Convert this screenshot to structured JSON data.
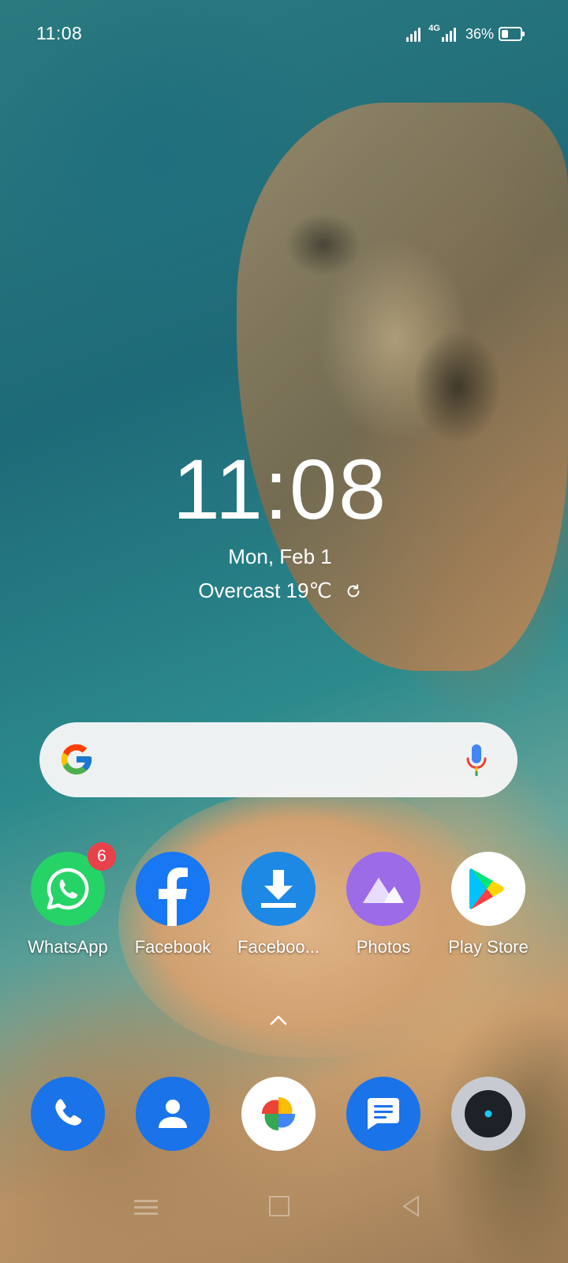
{
  "status_bar": {
    "time": "11:08",
    "network_label": "4G",
    "battery_percent": "36%",
    "battery_level": 0.36
  },
  "clock_widget": {
    "time": "11:08",
    "date": "Mon, Feb 1",
    "weather": "Overcast 19℃"
  },
  "search_bar": {
    "logo_icon": "google-g-icon",
    "mic_icon": "microphone-icon"
  },
  "apps": [
    {
      "label": "WhatsApp",
      "icon": "whatsapp-icon",
      "badge": "6",
      "color": "#25D366"
    },
    {
      "label": "Facebook",
      "icon": "facebook-icon",
      "color": "#1877F2"
    },
    {
      "label": "Faceboo...",
      "icon": "download-icon",
      "color": "#1E88E5"
    },
    {
      "label": "Photos",
      "icon": "mountain-icon",
      "color": "#9B6BE8"
    },
    {
      "label": "Play Store",
      "icon": "play-store-icon",
      "color": "#FFFFFF"
    }
  ],
  "dock": [
    {
      "icon": "phone-icon",
      "color": "#1A73E8"
    },
    {
      "icon": "contacts-icon",
      "color": "#1A73E8"
    },
    {
      "icon": "google-photos-icon",
      "color": "#FFFFFF"
    },
    {
      "icon": "messages-icon",
      "color": "#1A73E8"
    },
    {
      "icon": "camera-icon",
      "color": "#C7CBD1"
    }
  ]
}
